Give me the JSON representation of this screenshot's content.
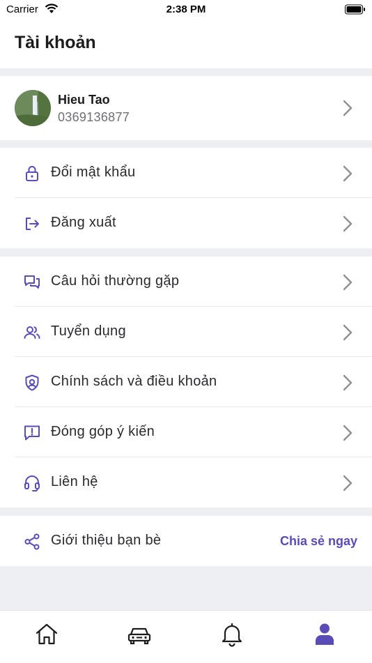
{
  "status_bar": {
    "carrier": "Carrier",
    "time": "2:38 PM"
  },
  "header": {
    "title": "Tài khoản"
  },
  "profile": {
    "name": "Hieu Tao",
    "phone": "0369136877"
  },
  "account_menu": [
    {
      "label": "Đổi mật khẩu",
      "icon": "lock-icon"
    },
    {
      "label": "Đăng xuất",
      "icon": "logout-icon"
    }
  ],
  "info_menu": [
    {
      "label": "Câu hỏi thường gặp",
      "icon": "chat-bubbles-icon"
    },
    {
      "label": "Tuyển dụng",
      "icon": "users-icon"
    },
    {
      "label": "Chính sách và điều khoản",
      "icon": "shield-icon"
    },
    {
      "label": "Đóng góp ý kiến",
      "icon": "feedback-icon"
    },
    {
      "label": "Liên hệ",
      "icon": "headset-icon"
    }
  ],
  "referral": {
    "label": "Giới thiệu bạn bè",
    "action": "Chia sẻ ngay",
    "icon": "share-icon"
  },
  "tabbar": [
    "home-icon",
    "car-icon",
    "bell-icon",
    "user-icon"
  ],
  "colors": {
    "accent": "#5a4cb6",
    "background": "#eeeff3",
    "chevron": "#8e8e93"
  }
}
